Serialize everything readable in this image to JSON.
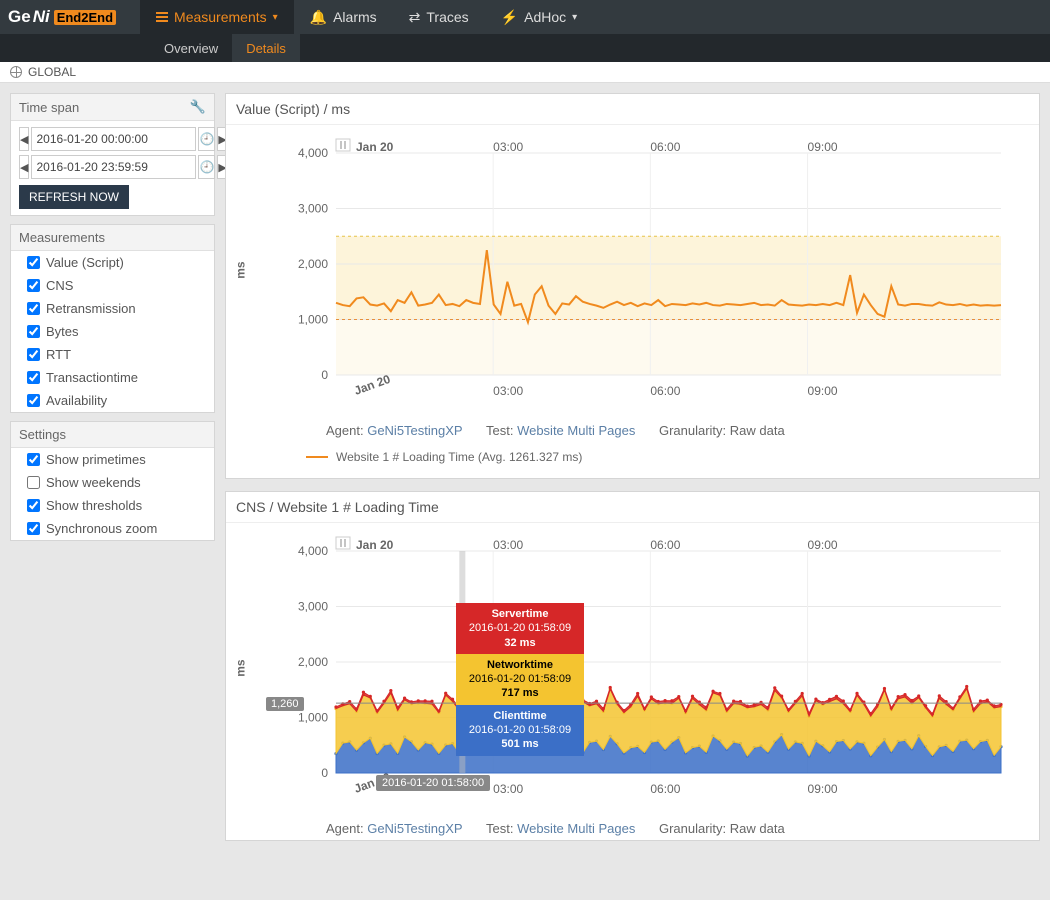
{
  "nav": {
    "logo_ge": "Ge",
    "logo_ni": "Ni",
    "logo_e2e": "End2End",
    "measurements": "Measurements",
    "alarms": "Alarms",
    "traces": "Traces",
    "adhoc": "AdHoc"
  },
  "subnav": {
    "overview": "Overview",
    "details": "Details"
  },
  "global": "GLOBAL",
  "timespan": {
    "title": "Time span",
    "from": "2016-01-20 00:00:00",
    "to": "2016-01-20 23:59:59",
    "refresh": "REFRESH NOW"
  },
  "measurements_panel": {
    "title": "Measurements",
    "items": [
      {
        "label": "Value (Script)",
        "checked": true
      },
      {
        "label": "CNS",
        "checked": true
      },
      {
        "label": "Retransmission",
        "checked": true
      },
      {
        "label": "Bytes",
        "checked": true
      },
      {
        "label": "RTT",
        "checked": true
      },
      {
        "label": "Transactiontime",
        "checked": true
      },
      {
        "label": "Availability",
        "checked": true
      }
    ]
  },
  "settings_panel": {
    "title": "Settings",
    "items": [
      {
        "label": "Show primetimes",
        "checked": true
      },
      {
        "label": "Show weekends",
        "checked": false
      },
      {
        "label": "Show thresholds",
        "checked": true
      },
      {
        "label": "Synchronous zoom",
        "checked": true
      }
    ]
  },
  "chart1": {
    "title": "Value (Script) / ms",
    "ylabel": "ms",
    "agent_lbl": "Agent: ",
    "agent": "GeNi5TestingXP",
    "test_lbl": "Test: ",
    "test": "Website Multi Pages",
    "gran_lbl": "Granularity: ",
    "gran": "Raw data",
    "legend": "Website 1 # Loading Time (Avg. 1261.327 ms)"
  },
  "chart2": {
    "title": "CNS / Website 1 # Loading Time",
    "ylabel": "ms",
    "agent_lbl": "Agent: ",
    "agent": "GeNi5TestingXP",
    "test_lbl": "Test: ",
    "test": "Website Multi Pages",
    "gran_lbl": "Granularity: ",
    "gran": "Raw data",
    "y_marker": "1,260",
    "time_marker": "2016-01-20 01:58:00",
    "tooltip": {
      "server": {
        "title": "Servertime",
        "ts": "2016-01-20 01:58:09",
        "val": "32 ms"
      },
      "network": {
        "title": "Networktime",
        "ts": "2016-01-20 01:58:09",
        "val": "717 ms"
      },
      "client": {
        "title": "Clienttime",
        "ts": "2016-01-20 01:58:09",
        "val": "501 ms"
      }
    }
  },
  "chart_data": [
    {
      "type": "line",
      "title": "Value (Script) / ms",
      "ylabel": "ms",
      "ylim": [
        0,
        4000
      ],
      "x_ticks": [
        "Jan 20",
        "03:00",
        "06:00",
        "09:00"
      ],
      "y_ticks": [
        0,
        1000,
        2000,
        3000,
        4000
      ],
      "thresholds": [
        2500,
        1000
      ],
      "series": [
        {
          "name": "Website 1 # Loading Time",
          "avg": 1261.327,
          "color": "#f08a1e",
          "values": [
            1300,
            1260,
            1240,
            1380,
            1400,
            1270,
            1250,
            1290,
            1150,
            1350,
            1300,
            1490,
            1250,
            1270,
            1300,
            1450,
            1260,
            1280,
            1240,
            1350,
            1300,
            1280,
            2250,
            1270,
            1100,
            1680,
            1250,
            1280,
            950,
            1450,
            1600,
            1250,
            1100,
            1290,
            1270,
            1420,
            1320,
            1280,
            1250,
            1210,
            1270,
            1320,
            1260,
            1300,
            1240,
            1290,
            1260,
            1350,
            1240,
            1280,
            1270,
            1260,
            1290,
            1270,
            1300,
            1260,
            1250,
            1280,
            1270,
            1260,
            1280,
            1300,
            1260,
            1270,
            1250,
            1350,
            1270,
            1260,
            1250,
            1270,
            1260,
            1280,
            1260,
            1300,
            1260,
            1800,
            1120,
            1450,
            1260,
            1100,
            1050,
            1600,
            1270,
            1250,
            1280,
            1280,
            1260,
            1250,
            1310,
            1270,
            1260,
            1280,
            1250,
            1270,
            1250,
            1260,
            1250,
            1260
          ]
        }
      ]
    },
    {
      "type": "area",
      "title": "CNS / Website 1 # Loading Time",
      "ylabel": "ms",
      "ylim": [
        0,
        4000
      ],
      "x_ticks": [
        "Jan 20",
        "03:00",
        "06:00",
        "09:00"
      ],
      "y_ticks": [
        0,
        1000,
        2000,
        3000,
        4000
      ],
      "y_marker": 1260,
      "cursor_time": "2016-01-20 01:58:00",
      "series": [
        {
          "name": "Clienttime",
          "color": "#3b6fc7",
          "sample_ts": "2016-01-20 01:58:09",
          "sample_val": 501
        },
        {
          "name": "Networktime",
          "color": "#f4c430",
          "sample_ts": "2016-01-20 01:58:09",
          "sample_val": 717
        },
        {
          "name": "Servertime",
          "color": "#d62728",
          "sample_ts": "2016-01-20 01:58:09",
          "sample_val": 32
        }
      ]
    }
  ]
}
